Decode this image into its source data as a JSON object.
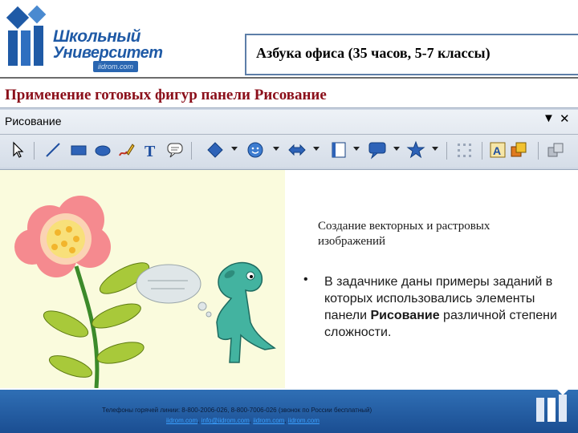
{
  "header": {
    "logo_line1": "Школьный",
    "logo_line2": "Университет",
    "logo_url": "iidrom.com",
    "course_title": "Азбука офиса (35 часов, 5-7 классы)"
  },
  "slide_title": "Применение готовых фигур панели Рисование",
  "toolbar": {
    "title": "Рисование",
    "menu_glyph": "▼",
    "close_glyph": "✕",
    "tools": [
      {
        "icon": "select-arrow-icon"
      },
      {
        "icon": "line-icon"
      },
      {
        "icon": "rectangle-icon"
      },
      {
        "icon": "oval-icon"
      },
      {
        "icon": "freeform-icon"
      },
      {
        "icon": "text-icon",
        "glyph": "T"
      },
      {
        "icon": "callout-icon"
      },
      {
        "icon": "basic-shapes-icon"
      },
      {
        "icon": "symbol-shapes-icon"
      },
      {
        "icon": "block-arrows-icon"
      },
      {
        "icon": "flowchart-icon"
      },
      {
        "icon": "callouts-icon"
      },
      {
        "icon": "stars-icon"
      },
      {
        "icon": "points-icon"
      },
      {
        "icon": "fontwork-icon"
      },
      {
        "icon": "3d-objects-icon"
      },
      {
        "icon": "extrusion-icon"
      }
    ]
  },
  "content": {
    "heading": "Создание векторных и растровых изображений",
    "bullet_glyph": "•",
    "bullet_before": "В задачнике даны примеры заданий в которых использовались элементы панели ",
    "bullet_bold": "Рисование",
    "bullet_after": " различной степени сложности."
  },
  "footer": {
    "hotline": "Телефоны горячей линии: 8-800-2006-026, 8-800-7006-026 (звонок по России бесплатный)",
    "links": [
      "iidrom.com",
      "info@iidrom.com",
      "iidrom.com",
      "iidrom.com"
    ],
    "link_separator": ","
  },
  "colors": {
    "brand_blue": "#1f5aa6",
    "title_red": "#8b0f1a",
    "illustration_bg": "#fafbdd",
    "footer_blue": "#2a63a8"
  }
}
